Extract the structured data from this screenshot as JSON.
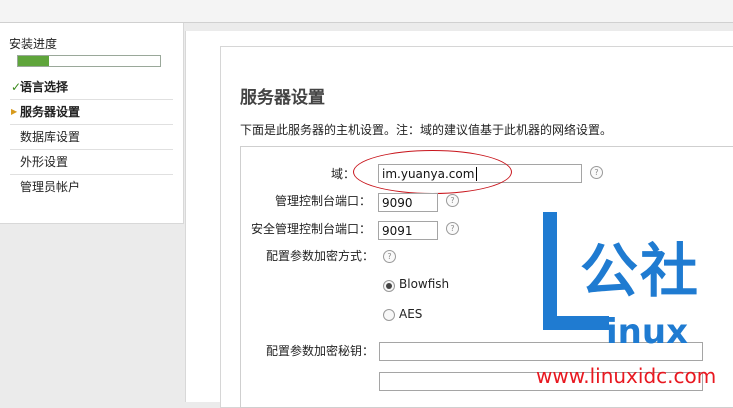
{
  "sidebar": {
    "progress_title": "安装进度",
    "progress_fraction": 0.22,
    "steps": [
      {
        "label": "语言选择",
        "state": "done",
        "mark": "✓"
      },
      {
        "label": "服务器设置",
        "state": "current",
        "mark": "▶"
      },
      {
        "label": "数据库设置",
        "state": "pending",
        "mark": ""
      },
      {
        "label": "外形设置",
        "state": "pending",
        "mark": ""
      },
      {
        "label": "管理员帐户",
        "state": "pending",
        "mark": ""
      }
    ]
  },
  "main": {
    "title": "服务器设置",
    "description": "下面是此服务器的主机设置。注：域的建议值基于此机器的网络设置。",
    "fields": {
      "domain": {
        "label": "域：",
        "value": "im.yuanya.com"
      },
      "admin_port": {
        "label": "管理控制台端口：",
        "value": "9090"
      },
      "secure_admin_port": {
        "label": "安全管理控制台端口：",
        "value": "9091"
      },
      "encryption_method": {
        "label": "配置参数加密方式：",
        "options": [
          "Blowfish",
          "AES"
        ],
        "selected": "Blowfish"
      },
      "encryption_key": {
        "label": "配置参数加密秘钥：",
        "value": "",
        "confirm_value": ""
      }
    },
    "help_glyph": "?"
  },
  "watermark": {
    "gongshe": "公社",
    "inux": "inux",
    "url": "www.linuxidc.com",
    "brand_color": "#1f7bd1",
    "url_color": "#e81820"
  },
  "colors": {
    "progress_fill": "#5fa53b",
    "done_check": "#3a8a1c",
    "current_arrow": "#d79a1c",
    "highlight_ellipse": "#c8151c"
  }
}
